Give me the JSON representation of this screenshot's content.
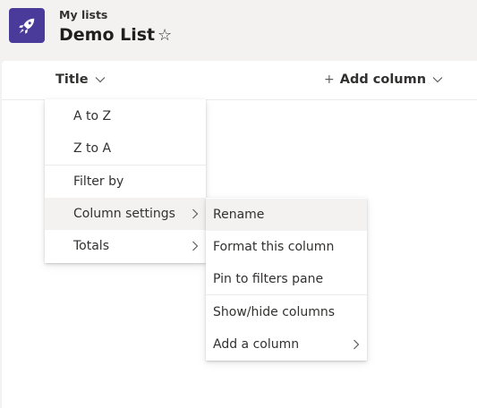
{
  "header": {
    "breadcrumb": "My lists",
    "list_title": "Demo List",
    "app_icon": "rocket-icon",
    "favorite_icon": "star-outline-icon",
    "star_glyph": "☆"
  },
  "columns": {
    "title_label": "Title",
    "add_plus": "+",
    "add_column_label": "Add column"
  },
  "column_menu": {
    "items": [
      {
        "label": "A to Z"
      },
      {
        "label": "Z to A"
      },
      {
        "label": "Filter by"
      },
      {
        "label": "Column settings",
        "has_submenu": true,
        "highlighted": true
      },
      {
        "label": "Totals",
        "has_submenu": true
      }
    ]
  },
  "settings_submenu": {
    "items": [
      {
        "label": "Rename",
        "highlighted": true
      },
      {
        "label": "Format this column"
      },
      {
        "label": "Pin to filters pane"
      },
      {
        "label": "Show/hide columns"
      },
      {
        "label": "Add a column",
        "has_submenu": true
      }
    ]
  },
  "colors": {
    "brand": "#4a3a9a",
    "highlight": "#f3f2f1",
    "text": "#323130"
  }
}
